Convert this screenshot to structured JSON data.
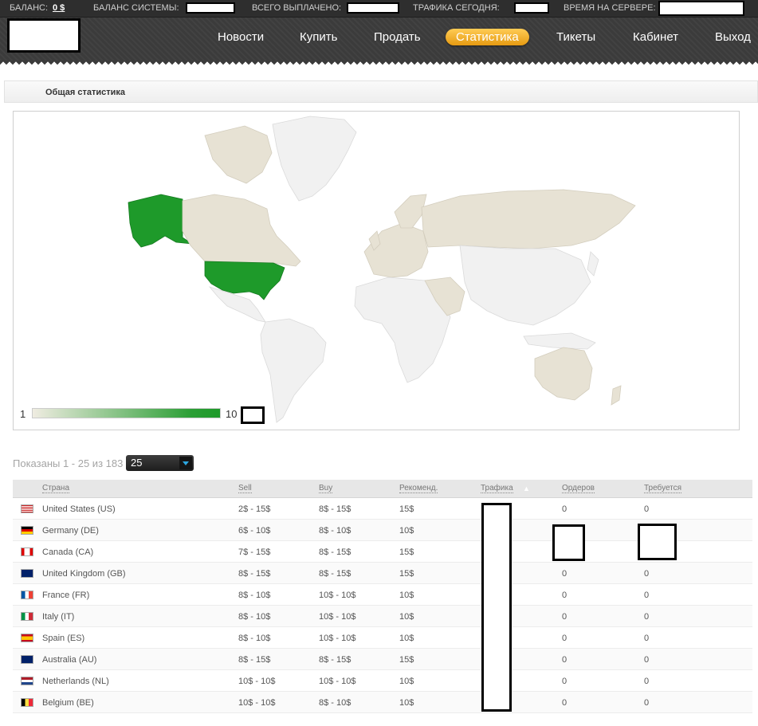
{
  "statusbar": {
    "balance_label": "БАЛАНС:",
    "balance_value": "0 $",
    "system_balance_label": "БАЛАНС СИСТЕМЫ:",
    "total_paid_label": "ВСЕГО ВЫПЛАЧЕНО:",
    "traffic_today_label": "ТРАФИКА СЕГОДНЯ:",
    "server_time_label": "ВРЕМЯ НА СЕРВЕРЕ:"
  },
  "nav": {
    "items": [
      "Новости",
      "Купить",
      "Продать",
      "Статистика",
      "Тикеты",
      "Кабинет",
      "Выход"
    ],
    "active": "Статистика"
  },
  "panel": {
    "title": "Общая статистика"
  },
  "map": {
    "legend_min": "1",
    "legend_max": "10",
    "colors": {
      "none": "#f1f1f1",
      "low": "#e7e2d4",
      "high": "#1e9a2a"
    },
    "high_countries": [
      "United States",
      "Alaska (US)"
    ],
    "low_countries": [
      "Canada",
      "Greenland",
      "Russia",
      "Europe",
      "Middle East",
      "Australia"
    ]
  },
  "pager": {
    "shown": "Показаны 1 - 25 из 183",
    "per_page": "25"
  },
  "table": {
    "headers": [
      "Страна",
      "Sell",
      "Buy",
      "Рекоменд.",
      "Трафика",
      "Ордеров",
      "Требуется"
    ],
    "sort_icon": "sort-asc-icon",
    "rows": [
      {
        "flag": "us-flag-icon",
        "country": "United States (US)",
        "sell": "2$ - 15$",
        "buy": "8$ - 15$",
        "rec": "15$",
        "orders": "0",
        "required": "0"
      },
      {
        "flag": "de-flag-icon",
        "country": "Germany (DE)",
        "sell": "6$ - 10$",
        "buy": "8$ - 10$",
        "rec": "10$",
        "orders": "",
        "required": ""
      },
      {
        "flag": "ca-flag-icon",
        "country": "Canada (CA)",
        "sell": "7$ - 15$",
        "buy": "8$ - 15$",
        "rec": "15$",
        "orders": "",
        "required": ""
      },
      {
        "flag": "gb-flag-icon",
        "country": "United Kingdom (GB)",
        "sell": "8$ - 15$",
        "buy": "8$ - 15$",
        "rec": "15$",
        "orders": "0",
        "required": "0"
      },
      {
        "flag": "fr-flag-icon",
        "country": "France (FR)",
        "sell": "8$ - 10$",
        "buy": "10$ - 10$",
        "rec": "10$",
        "orders": "0",
        "required": "0"
      },
      {
        "flag": "it-flag-icon",
        "country": "Italy (IT)",
        "sell": "8$ - 10$",
        "buy": "10$ - 10$",
        "rec": "10$",
        "orders": "0",
        "required": "0"
      },
      {
        "flag": "es-flag-icon",
        "country": "Spain (ES)",
        "sell": "8$ - 10$",
        "buy": "10$ - 10$",
        "rec": "10$",
        "orders": "0",
        "required": "0"
      },
      {
        "flag": "au-flag-icon",
        "country": "Australia (AU)",
        "sell": "8$ - 15$",
        "buy": "8$ - 15$",
        "rec": "15$",
        "orders": "0",
        "required": "0"
      },
      {
        "flag": "nl-flag-icon",
        "country": "Netherlands (NL)",
        "sell": "10$ - 10$",
        "buy": "10$ - 10$",
        "rec": "10$",
        "orders": "0",
        "required": "0"
      },
      {
        "flag": "be-flag-icon",
        "country": "Belgium (BE)",
        "sell": "10$ - 10$",
        "buy": "8$ - 10$",
        "rec": "10$",
        "orders": "0",
        "required": "0"
      }
    ]
  }
}
